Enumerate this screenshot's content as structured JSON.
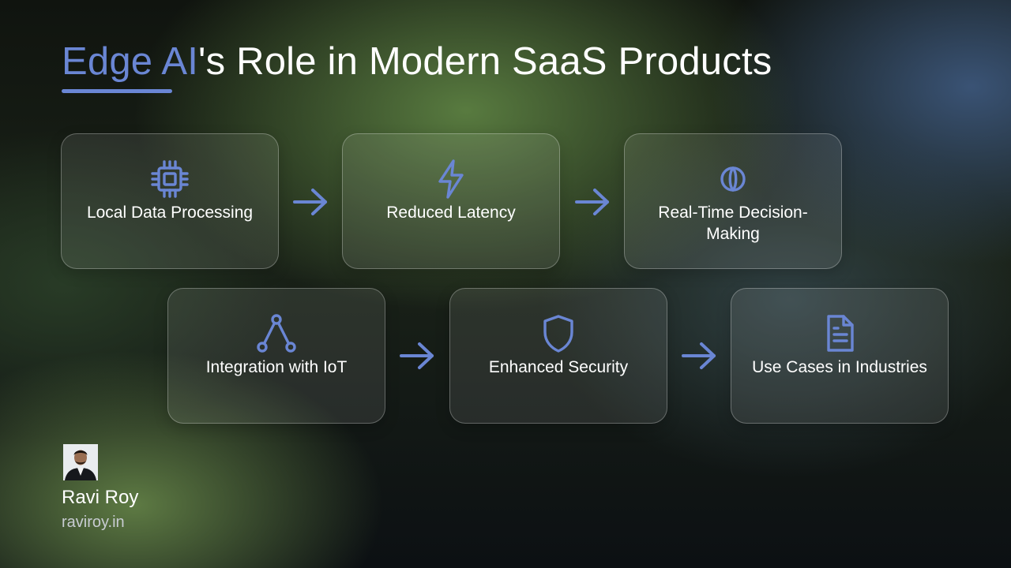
{
  "title": {
    "accent": "Edge AI",
    "rest": "'s Role in Modern SaaS Products"
  },
  "colors": {
    "accent": "#6a86d4",
    "text": "#ffffff",
    "muted": "#c8ccd2"
  },
  "steps": [
    {
      "label": "Local Data Processing",
      "icon": "cpu-chip-icon"
    },
    {
      "label": "Reduced Latency",
      "icon": "lightning-bolt-icon"
    },
    {
      "label": "Real-Time Decision-Making",
      "icon": "brain-icon"
    },
    {
      "label": "Integration with IoT",
      "icon": "network-nodes-icon"
    },
    {
      "label": "Enhanced Security",
      "icon": "shield-icon"
    },
    {
      "label": "Use Cases in Industries",
      "icon": "document-icon"
    }
  ],
  "author": {
    "name": "Ravi Roy",
    "website": "raviroy.in"
  }
}
